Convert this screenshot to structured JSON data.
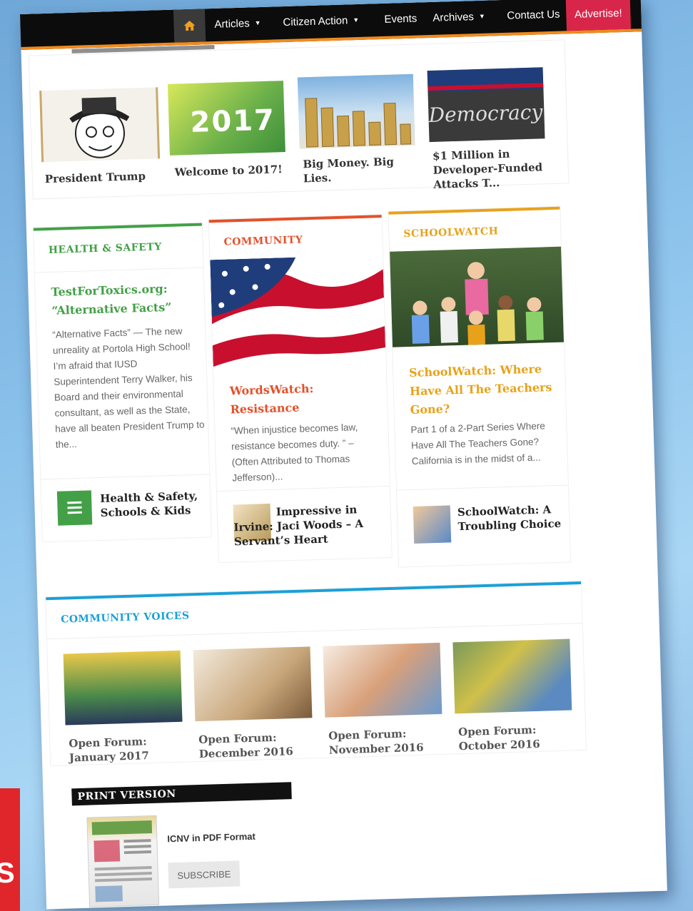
{
  "nav": {
    "home_icon": "home-icon",
    "items": [
      {
        "label": "Articles",
        "has_caret": true
      },
      {
        "label": "Citizen Action",
        "has_caret": true
      },
      {
        "label": "Events",
        "has_caret": false
      },
      {
        "label": "Archives",
        "has_caret": true
      },
      {
        "label": "Contact Us",
        "has_caret": false
      }
    ],
    "advertise": "Advertise!",
    "accent": "#f08a1d",
    "advertise_color": "#d8264a"
  },
  "featured": [
    {
      "caption": "President Trump"
    },
    {
      "caption": "Welcome to 2017!",
      "thumb_text": "2017"
    },
    {
      "caption": "Big Money. Big Lies."
    },
    {
      "caption": "$1 Million in Developer-Funded Attacks T..."
    }
  ],
  "sections": {
    "health": {
      "title": "HEALTH & SAFETY",
      "color": "#43a047",
      "article_title": "TestForToxics.org: “Alternative Facts”",
      "excerpt": "“Alternative Facts” — The new unreality at Portola High School! I’m afraid that IUSD Superintendent Terry Walker, his Board and their environmental consultant, as well as the State, have all beaten President Trump to the...",
      "related": "Health & Safety, Schools & Kids"
    },
    "community": {
      "title": "COMMUNITY",
      "color": "#e4502a",
      "article_title": "WordsWatch: Resistance",
      "excerpt": "“When injustice becomes law, resistance becomes duty. ” – (Often Attributed to Thomas Jefferson)...",
      "related": "Impressive in Irvine: Jaci Woods – A Servant’s Heart"
    },
    "schoolwatch": {
      "title": "SCHOOLWATCH",
      "color": "#e8a21a",
      "article_title": "SchoolWatch: Where Have All The Teachers Gone?",
      "excerpt": "Part 1 of a 2-Part Series Where Have All The Teachers Gone? California is in the midst of a...",
      "related": "SchoolWatch: A Troubling Choice"
    }
  },
  "voices": {
    "title": "COMMUNITY VOICES",
    "color": "#1aa0d8",
    "items": [
      {
        "caption": "Open Forum: January 2017"
      },
      {
        "caption": "Open Forum: December 2016"
      },
      {
        "caption": "Open Forum: November 2016"
      },
      {
        "caption": "Open Forum: October 2016"
      }
    ]
  },
  "print": {
    "title": "PRINT VERSION",
    "pdf_label": "ICNV in PDF Format",
    "subscribe": "SUBSCRIBE"
  },
  "side_tab": "S"
}
